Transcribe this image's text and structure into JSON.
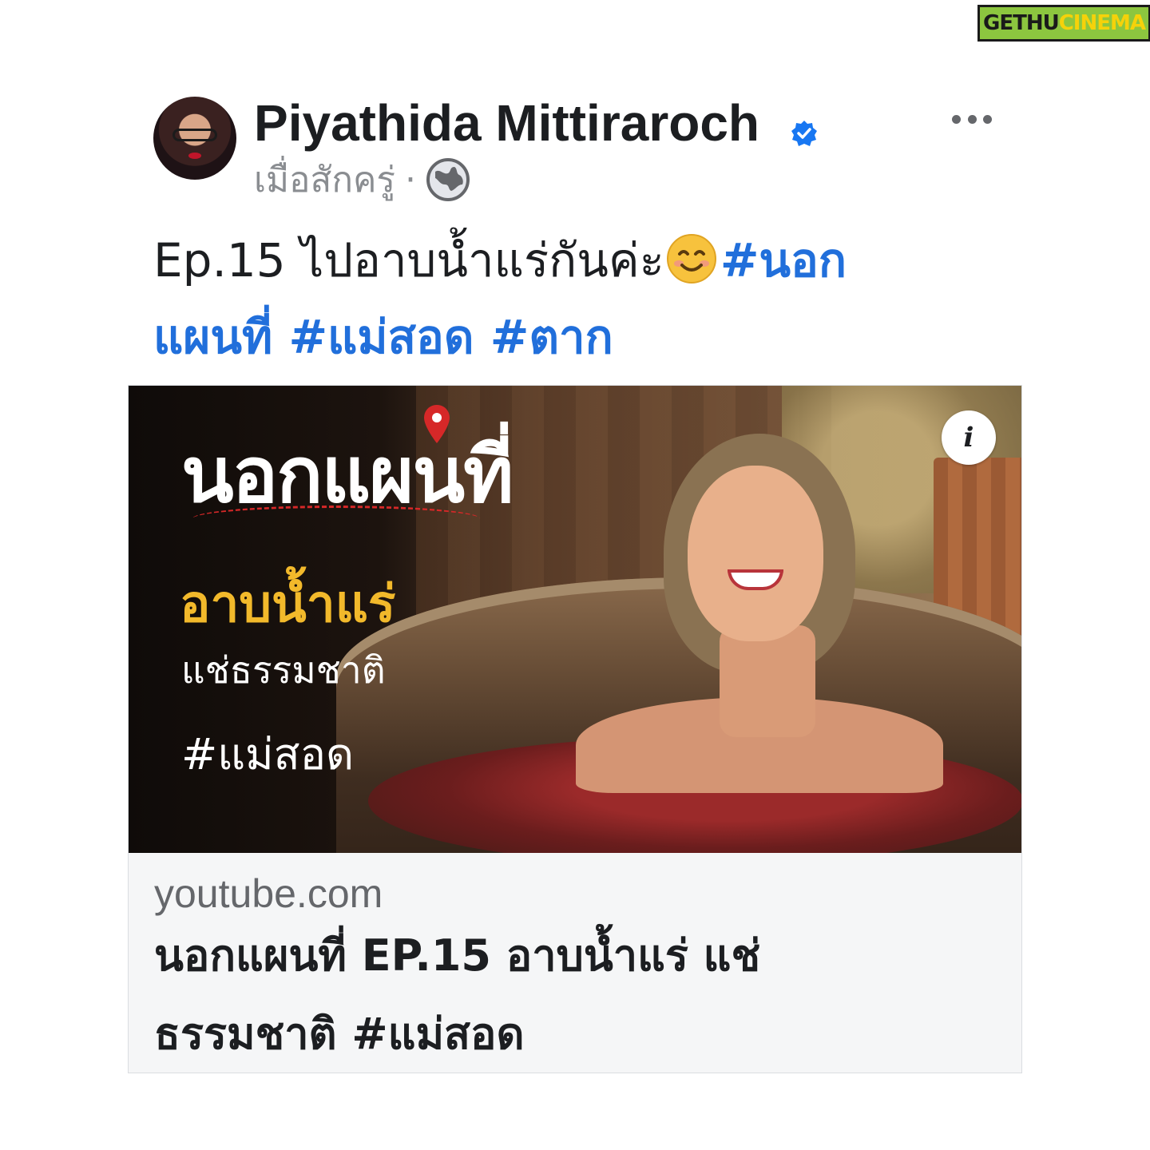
{
  "watermark": {
    "part_a": "GETHU",
    "part_b": "CINEMA"
  },
  "post": {
    "author": "Piyathida Mittiraroch",
    "timestamp": "เมื่อสักครู่",
    "separator": "·",
    "privacy_icon": "globe-icon",
    "more_icon": "more-options-icon",
    "verified_icon": "verified-badge-icon",
    "text_line1_plain": "Ep.15 ไปอาบน้ำแร่กันค่ะ",
    "emoji": "smiling-face-icon",
    "text_line1_hashtag": "#นอก",
    "text_line2_hashtags": "แผนที่ #แม่สอด #ตาก"
  },
  "link_card": {
    "thumbnail": {
      "title": "นอกแผนที่",
      "line1": "อาบน้ำแร่",
      "line2": "แช่ธรรมชาติ",
      "line3": "#แม่สอด",
      "info_label": "i"
    },
    "domain": "youtube.com",
    "title_line1": "นอกแผนที่ EP.15 อาบน้ำแร่ แช่",
    "title_line2": "ธรรมชาติ #แม่สอด"
  },
  "colors": {
    "hashtag": "#216fdb",
    "verified": "#1877f2",
    "card_bg": "#f5f6f7",
    "thumb_accent_yellow": "#f2b92b",
    "thumb_accent_red": "#d62828"
  }
}
